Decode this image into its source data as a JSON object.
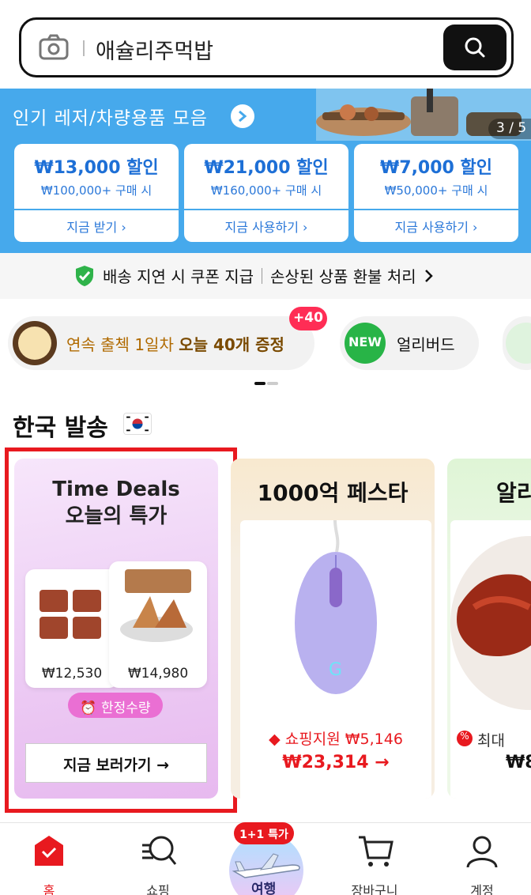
{
  "search": {
    "query": "애슐리주먹밥"
  },
  "banner": {
    "text": "인기 레저/차량용품 모음",
    "pager": "3 / 5",
    "coupons": [
      {
        "amount": "₩13,000 할인",
        "condition": "₩100,000+ 구매 시",
        "action": "지금 받기"
      },
      {
        "amount": "₩21,000 할인",
        "condition": "₩160,000+ 구매 시",
        "action": "지금 사용하기"
      },
      {
        "amount": "₩7,000 할인",
        "condition": "₩50,000+ 구매 시",
        "action": "지금 사용하기"
      }
    ]
  },
  "notice": {
    "left": "배송 지연 시 쿠폰 지급",
    "right": "손상된 상품 환불 처리"
  },
  "chips": {
    "attendance_prefix": "연속 출첵 1일차",
    "attendance_bold": "오늘 40개 증정",
    "badge": "+40",
    "new_label": "NEW",
    "early_bird": "얼리버드"
  },
  "section": {
    "title": "한국 발송"
  },
  "cards": {
    "time_deals": {
      "title_en": "Time Deals",
      "title_ko": "오늘의 특가",
      "price1": "₩12,530",
      "price2": "₩14,980",
      "limited": "한정수량",
      "cta": "지금 보러가기 →"
    },
    "fest": {
      "title": "1000억 페스타",
      "support": "쇼핑지원 ₩5,146",
      "price": "₩23,314 →"
    },
    "third": {
      "title": "알리",
      "max": "최대",
      "price": "₩8"
    }
  },
  "nav": {
    "home": "홈",
    "shopping": "쇼핑",
    "center_badge": "1+1 특가",
    "center_label": "여행",
    "cart": "장바구니",
    "account": "계정"
  },
  "colors": {
    "accent": "#e8191f",
    "banner": "#46a9ec",
    "coupon_text": "#1d6fd6"
  }
}
